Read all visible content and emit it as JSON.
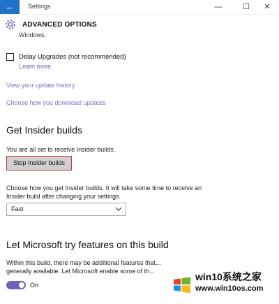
{
  "window": {
    "title": "Settings",
    "back_icon": "←",
    "minimize_icon": "—",
    "maximize_icon": "☐",
    "close_icon": "✕",
    "accent_color": "#1e73c8"
  },
  "header": {
    "title": "ADVANCED OPTIONS"
  },
  "content": {
    "truncated_text": "Windows.",
    "delay_upgrades": {
      "label": "Delay Upgrades (not recommended)",
      "checked": false
    },
    "learn_more": "Learn more",
    "link_history": "View your update history",
    "link_download": "Choose how you download updates",
    "insider": {
      "heading": "Get Insider builds",
      "status": "You are all set to receive Insider builds.",
      "stop_button": "Stop Insider builds",
      "description": "Choose how you get Insider builds. It will take some time to receive an Insider build after changing your settings.",
      "ring_selected": "Fast"
    },
    "features": {
      "heading": "Let Microsoft try features on this build",
      "description": "Within this build, there may be additional features that... generally available. Let Microsoft enable some of th...",
      "toggle_label": "On",
      "toggle_on": true,
      "toggle_color": "#6d63bd"
    }
  },
  "watermark": {
    "title": "win10系统之家",
    "url": "www.win10os.com"
  }
}
